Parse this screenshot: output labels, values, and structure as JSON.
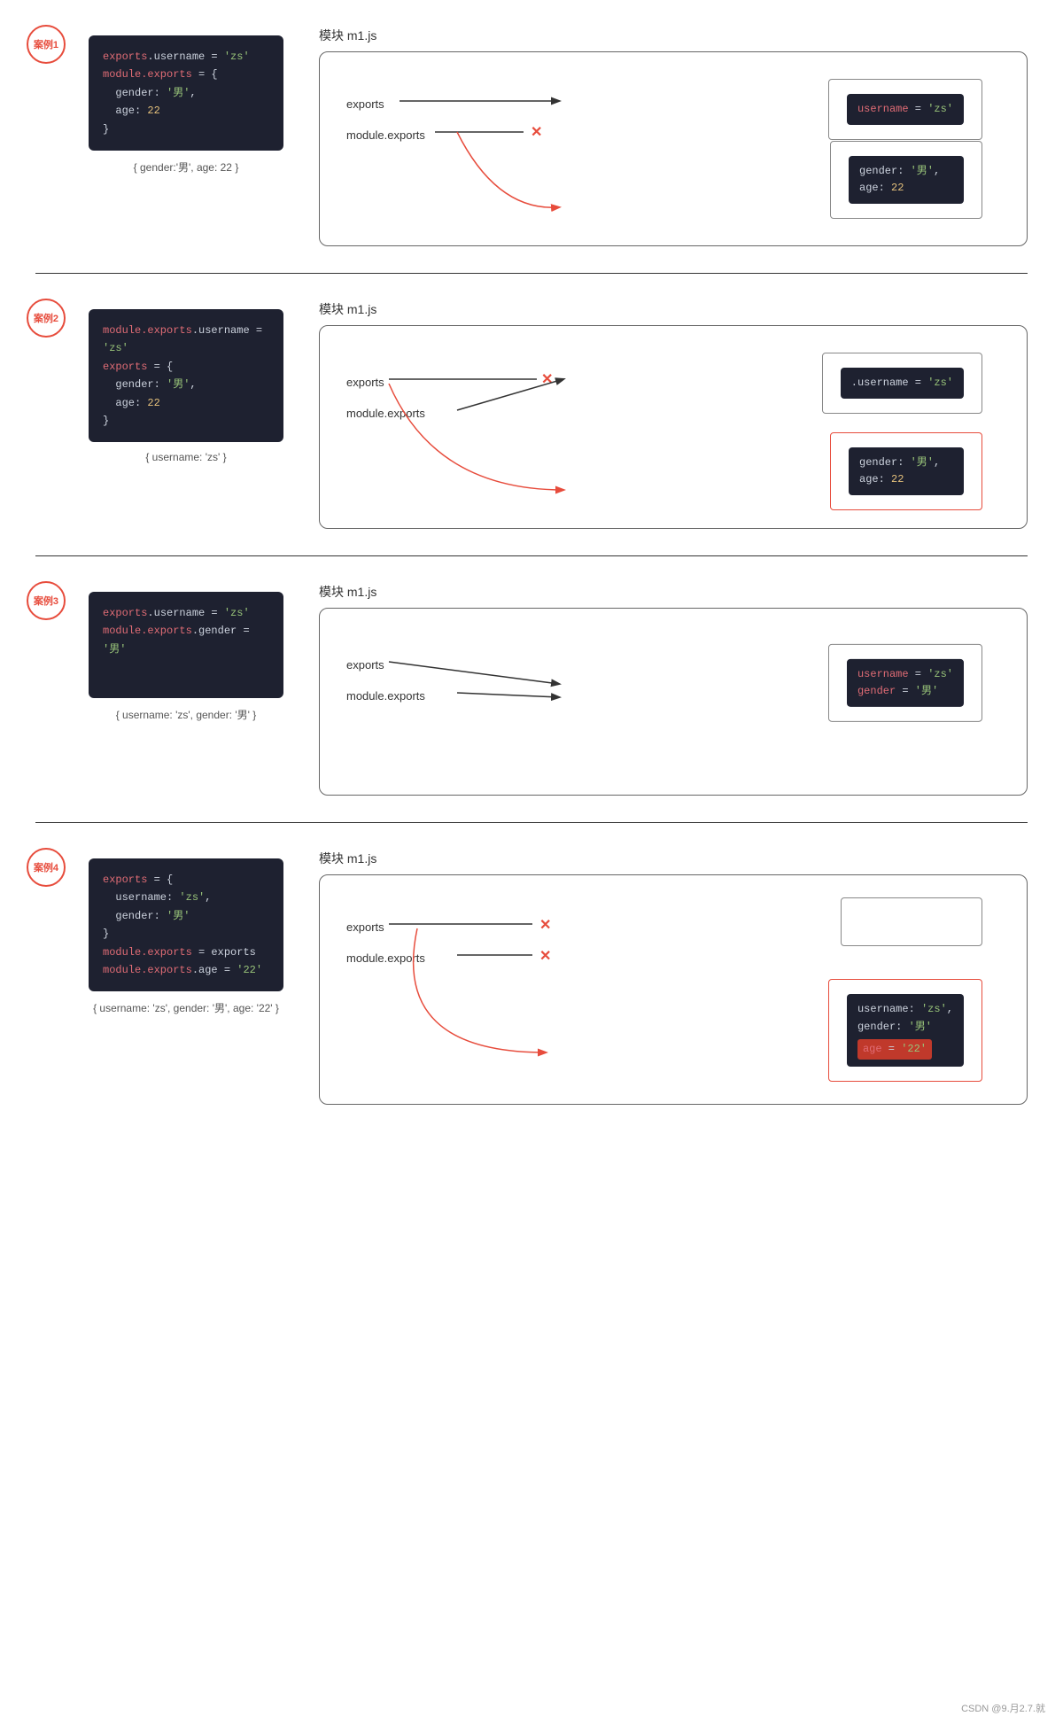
{
  "watermark": "CSDN @9.月2.7.就",
  "sections": [
    {
      "id": "case1",
      "badge": "案例1",
      "module_title": "模块  m1.js",
      "code_lines": [
        {
          "parts": [
            {
              "text": "exports",
              "cls": "code-red"
            },
            {
              "text": ".username = ",
              "cls": "code-white"
            },
            {
              "text": "'zs'",
              "cls": "code-green"
            }
          ]
        },
        {
          "parts": [
            {
              "text": "module.exports",
              "cls": "code-red"
            },
            {
              "text": " = {",
              "cls": "code-white"
            }
          ]
        },
        {
          "parts": [
            {
              "text": "  gender: ",
              "cls": "code-white"
            },
            {
              "text": "'男'",
              "cls": "code-green"
            },
            {
              "text": ",",
              "cls": "code-white"
            }
          ]
        },
        {
          "parts": [
            {
              "text": "  age: ",
              "cls": "code-white"
            },
            {
              "text": "22",
              "cls": "code-yellow"
            }
          ]
        },
        {
          "parts": [
            {
              "text": "}",
              "cls": "code-white"
            }
          ]
        }
      ],
      "caption": "{ gender:'男', age: 22 }",
      "exports_label": "exports",
      "module_exports_label": "module.exports",
      "box1": {
        "type": "normal",
        "lines": [
          {
            "parts": [
              {
                "text": "username",
                "cls": "code-red"
              },
              {
                "text": " = ",
                "cls": "code-white"
              },
              {
                "text": "'zs'",
                "cls": "code-green"
              }
            ]
          }
        ]
      },
      "box2": {
        "type": "normal",
        "lines": [
          {
            "parts": [
              {
                "text": "gender: ",
                "cls": "code-white"
              },
              {
                "text": "'男'",
                "cls": "code-green"
              },
              {
                "text": ",",
                "cls": "code-white"
              }
            ]
          },
          {
            "parts": [
              {
                "text": "age: ",
                "cls": "code-white"
              },
              {
                "text": "22",
                "cls": "code-yellow"
              }
            ]
          }
        ]
      },
      "exports_points_to": "box1",
      "module_points_to": "box2",
      "exports_x_mark": false,
      "module_x_mark": true,
      "arrow_style": "case1"
    },
    {
      "id": "case2",
      "badge": "案例2",
      "module_title": "模块  m1.js",
      "code_lines": [
        {
          "parts": [
            {
              "text": "module.exports",
              "cls": "code-red"
            },
            {
              "text": ".username = ",
              "cls": "code-white"
            },
            {
              "text": "'zs'",
              "cls": "code-green"
            }
          ]
        },
        {
          "parts": [
            {
              "text": "exports",
              "cls": "code-red"
            },
            {
              "text": " = {",
              "cls": "code-white"
            }
          ]
        },
        {
          "parts": [
            {
              "text": "  gender: ",
              "cls": "code-white"
            },
            {
              "text": "'男'",
              "cls": "code-green"
            },
            {
              "text": ",",
              "cls": "code-white"
            }
          ]
        },
        {
          "parts": [
            {
              "text": "  age: ",
              "cls": "code-white"
            },
            {
              "text": "22",
              "cls": "code-yellow"
            }
          ]
        },
        {
          "parts": [
            {
              "text": "}",
              "cls": "code-white"
            }
          ]
        }
      ],
      "caption": "{ username: 'zs' }",
      "exports_label": "exports",
      "module_exports_label": "module.exports",
      "box1": {
        "type": "normal",
        "lines": [
          {
            "parts": [
              {
                "text": ".username = ",
                "cls": "code-white"
              },
              {
                "text": "'zs'",
                "cls": "code-green"
              }
            ]
          }
        ]
      },
      "box2": {
        "type": "outlined_red",
        "lines": [
          {
            "parts": [
              {
                "text": "gender: ",
                "cls": "code-white"
              },
              {
                "text": "'男'",
                "cls": "code-green"
              },
              {
                "text": ",",
                "cls": "code-white"
              }
            ]
          },
          {
            "parts": [
              {
                "text": "age: ",
                "cls": "code-white"
              },
              {
                "text": "22",
                "cls": "code-yellow"
              }
            ]
          }
        ]
      },
      "exports_x_mark": true,
      "module_x_mark": false,
      "arrow_style": "case2"
    },
    {
      "id": "case3",
      "badge": "案例3",
      "module_title": "模块  m1.js",
      "code_lines": [
        {
          "parts": [
            {
              "text": "exports",
              "cls": "code-red"
            },
            {
              "text": ".username = ",
              "cls": "code-white"
            },
            {
              "text": "'zs'",
              "cls": "code-green"
            }
          ]
        },
        {
          "parts": [
            {
              "text": "module.exports",
              "cls": "code-red"
            },
            {
              "text": ".gender = ",
              "cls": "code-white"
            },
            {
              "text": "'男'",
              "cls": "code-green"
            }
          ]
        }
      ],
      "caption": "{ username: 'zs', gender: '男' }",
      "exports_label": "exports",
      "module_exports_label": "module.exports",
      "box1": {
        "type": "normal",
        "lines": [
          {
            "parts": [
              {
                "text": "username",
                "cls": "code-red"
              },
              {
                "text": " = ",
                "cls": "code-white"
              },
              {
                "text": "'zs'",
                "cls": "code-green"
              }
            ]
          },
          {
            "parts": [
              {
                "text": "gender",
                "cls": "code-red"
              },
              {
                "text": " = ",
                "cls": "code-white"
              },
              {
                "text": "'男'",
                "cls": "code-green"
              }
            ]
          }
        ]
      },
      "exports_x_mark": false,
      "module_x_mark": false,
      "arrow_style": "case3"
    },
    {
      "id": "case4",
      "badge": "案例4",
      "module_title": "模块  m1.js",
      "code_lines": [
        {
          "parts": [
            {
              "text": "exports",
              "cls": "code-red"
            },
            {
              "text": " = {",
              "cls": "code-white"
            }
          ]
        },
        {
          "parts": [
            {
              "text": "  username: ",
              "cls": "code-white"
            },
            {
              "text": "'zs'",
              "cls": "code-green"
            },
            {
              "text": ",",
              "cls": "code-white"
            }
          ]
        },
        {
          "parts": [
            {
              "text": "  gender: ",
              "cls": "code-white"
            },
            {
              "text": "'男'",
              "cls": "code-green"
            }
          ]
        },
        {
          "parts": [
            {
              "text": "}",
              "cls": "code-white"
            }
          ]
        },
        {
          "parts": [
            {
              "text": "module.exports",
              "cls": "code-red"
            },
            {
              "text": " = exports",
              "cls": "code-white"
            }
          ]
        },
        {
          "parts": [
            {
              "text": "module.exports",
              "cls": "code-red"
            },
            {
              "text": ".age = ",
              "cls": "code-white"
            },
            {
              "text": "'22'",
              "cls": "code-green"
            }
          ]
        }
      ],
      "caption": "{ username: 'zs', gender: '男', age: '22' }",
      "exports_label": "exports",
      "module_exports_label": "module.exports",
      "box_top": {
        "type": "empty_outlined",
        "lines": []
      },
      "box_bottom": {
        "type": "outlined_red",
        "lines": [
          {
            "parts": [
              {
                "text": "username: ",
                "cls": "code-white"
              },
              {
                "text": "'zs'",
                "cls": "code-green"
              },
              {
                "text": ",",
                "cls": "code-white"
              }
            ]
          },
          {
            "parts": [
              {
                "text": "gender: ",
                "cls": "code-white"
              },
              {
                "text": "'男'",
                "cls": "code-green"
              }
            ]
          },
          {
            "parts": [
              {
                "text": "age",
                "cls": "code-red"
              },
              {
                "text": " = ",
                "cls": "code-white"
              },
              {
                "text": "'22'",
                "cls": "code-green"
              }
            ]
          }
        ]
      },
      "exports_x_mark": true,
      "module_x_mark": true,
      "arrow_style": "case4"
    }
  ]
}
